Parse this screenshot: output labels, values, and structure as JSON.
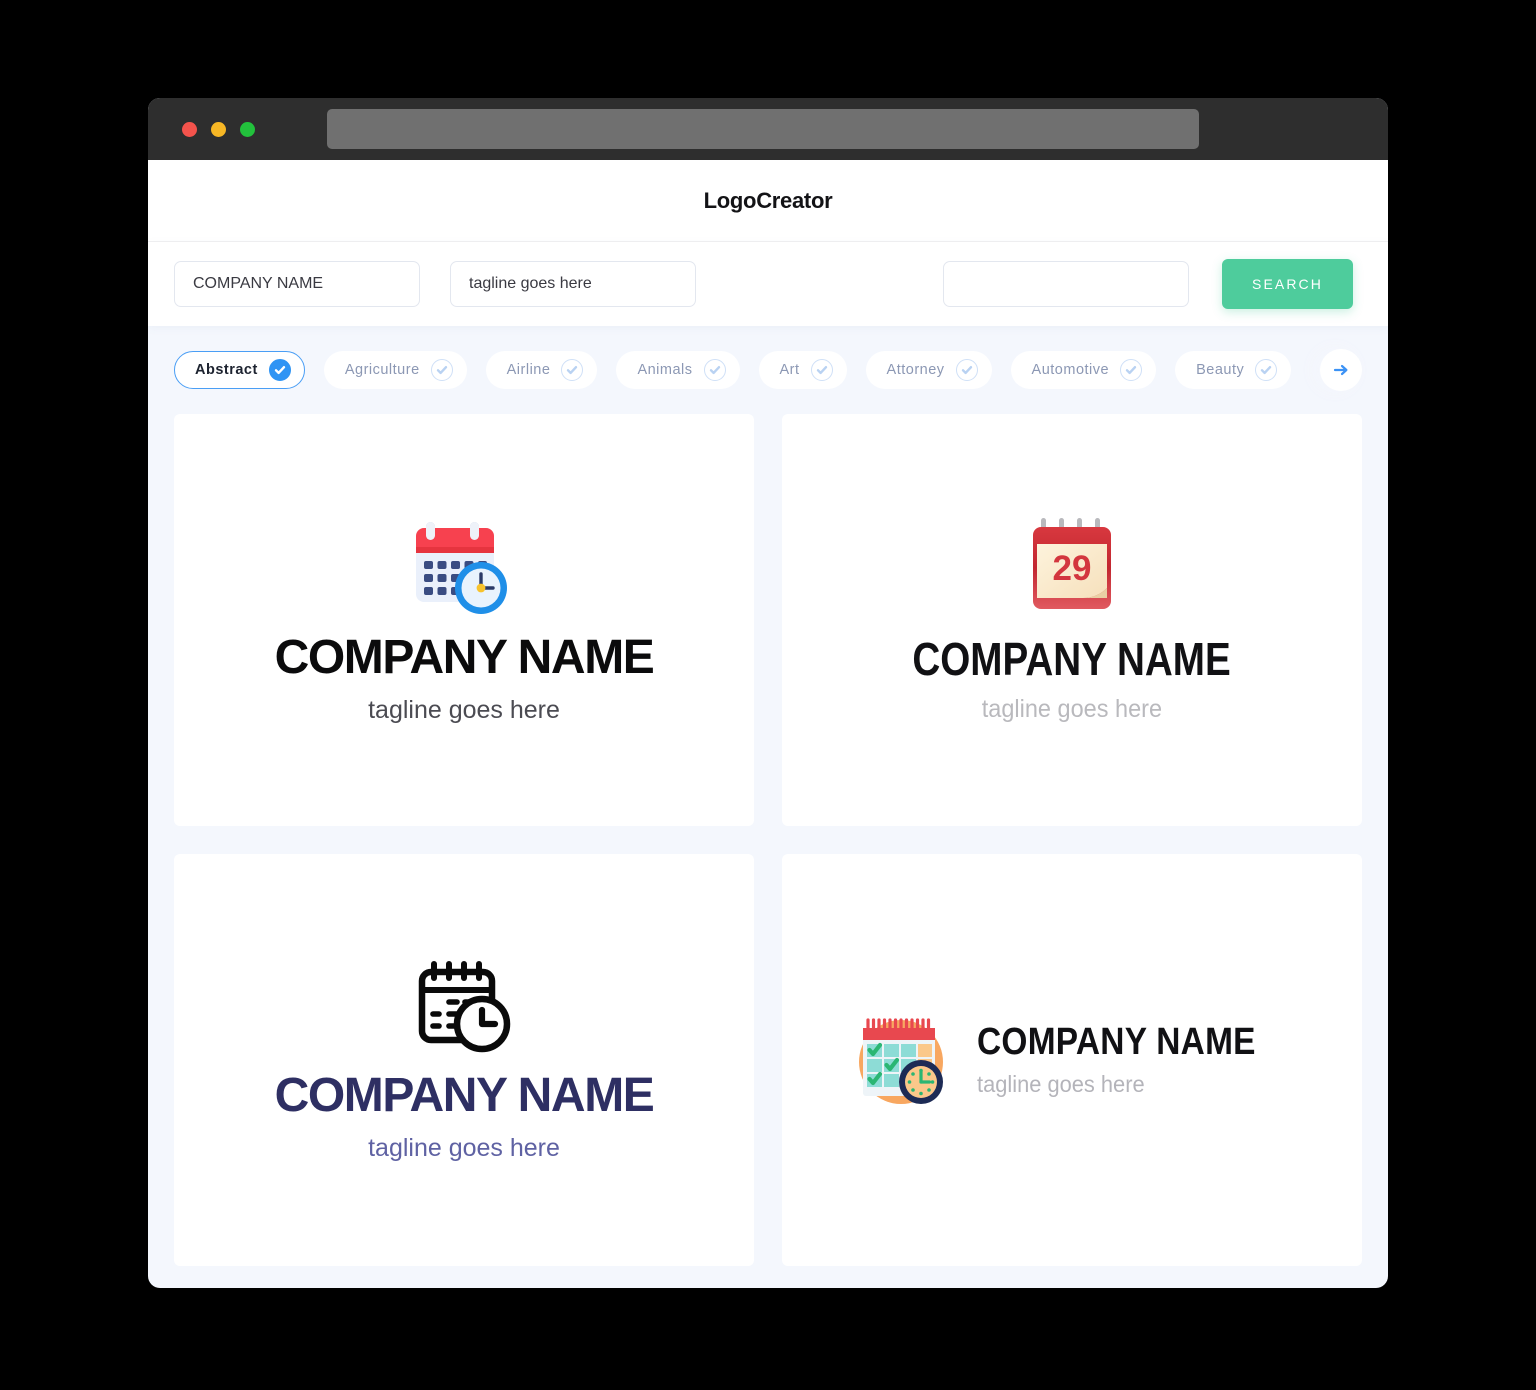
{
  "window": {
    "traffic_lights": [
      "close",
      "minimize",
      "maximize"
    ],
    "address_bar_value": ""
  },
  "header": {
    "title": "LogoCreator"
  },
  "search": {
    "company_name_value": "COMPANY NAME",
    "company_name_placeholder": "COMPANY NAME",
    "tagline_value": "tagline goes here",
    "tagline_placeholder": "tagline goes here",
    "keyword_value": "",
    "keyword_placeholder": "",
    "search_button_label": "SEARCH"
  },
  "categories": {
    "next_icon": "arrow-right-icon",
    "items": [
      {
        "label": "Abstract",
        "selected": true
      },
      {
        "label": "Agriculture",
        "selected": false
      },
      {
        "label": "Airline",
        "selected": false
      },
      {
        "label": "Animals",
        "selected": false
      },
      {
        "label": "Art",
        "selected": false
      },
      {
        "label": "Attorney",
        "selected": false
      },
      {
        "label": "Automotive",
        "selected": false
      },
      {
        "label": "Beauty",
        "selected": false
      }
    ]
  },
  "logos": [
    {
      "icon": "calendar-clock-flat-icon",
      "name": "COMPANY NAME",
      "tagline": "tagline goes here",
      "name_color": "#0b0b0c",
      "tagline_color": "#4b4b52",
      "layout": "stacked"
    },
    {
      "icon": "calendar-29-red-icon",
      "name": "COMPANY NAME",
      "tagline": "tagline goes here",
      "name_color": "#111114",
      "tagline_color": "#b9b9bd",
      "day_number": "29",
      "layout": "stacked"
    },
    {
      "icon": "calendar-clock-outline-icon",
      "name": "COMPANY NAME",
      "tagline": "tagline goes here",
      "name_color": "#2e2f63",
      "tagline_color": "#5f62a3",
      "layout": "stacked"
    },
    {
      "icon": "calendar-check-clock-circle-icon",
      "name": "COMPANY NAME",
      "tagline": "tagline goes here",
      "name_color": "#111114",
      "tagline_color": "#b4b4ba",
      "layout": "horizontal"
    }
  ],
  "colors": {
    "accent_green": "#4ecc9c",
    "accent_blue": "#2f94f4",
    "page_background": "#f4f7fd",
    "titlebar": "#2e2e2e"
  }
}
